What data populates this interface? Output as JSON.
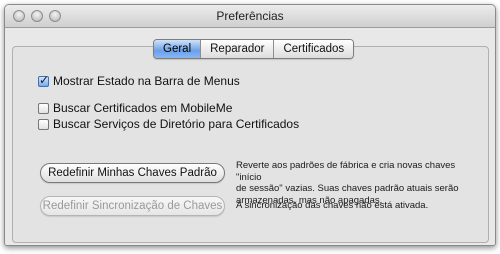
{
  "window": {
    "title": "Preferências"
  },
  "tabs": [
    {
      "label": "Geral",
      "selected": true
    },
    {
      "label": "Reparador",
      "selected": false
    },
    {
      "label": "Certificados",
      "selected": false
    }
  ],
  "options": [
    {
      "label": "Mostrar Estado na Barra de Menus",
      "checked": true
    },
    {
      "label": "Buscar Certificados em MobileMe",
      "checked": false
    },
    {
      "label": "Buscar Serviços de Diretório para Certificados",
      "checked": false
    }
  ],
  "actions": [
    {
      "button_label": "Redefinir Minhas Chaves Padrão",
      "enabled": true,
      "description_lines": [
        "Reverte aos padrões de fábrica e cria novas chaves \"início",
        "de sessão\" vazias. Suas chaves padrão atuais serão",
        "armazenadas, mas não apagadas."
      ]
    },
    {
      "button_label": "Redefinir Sincronização de Chaves",
      "enabled": false,
      "description_lines": [
        "A sincronização das chaves não está ativada."
      ]
    }
  ],
  "colors": {
    "selected_tab": "#6aa0e8",
    "checkbox_checked": "#78aaea",
    "disabled_text": "#9a9a9a"
  }
}
